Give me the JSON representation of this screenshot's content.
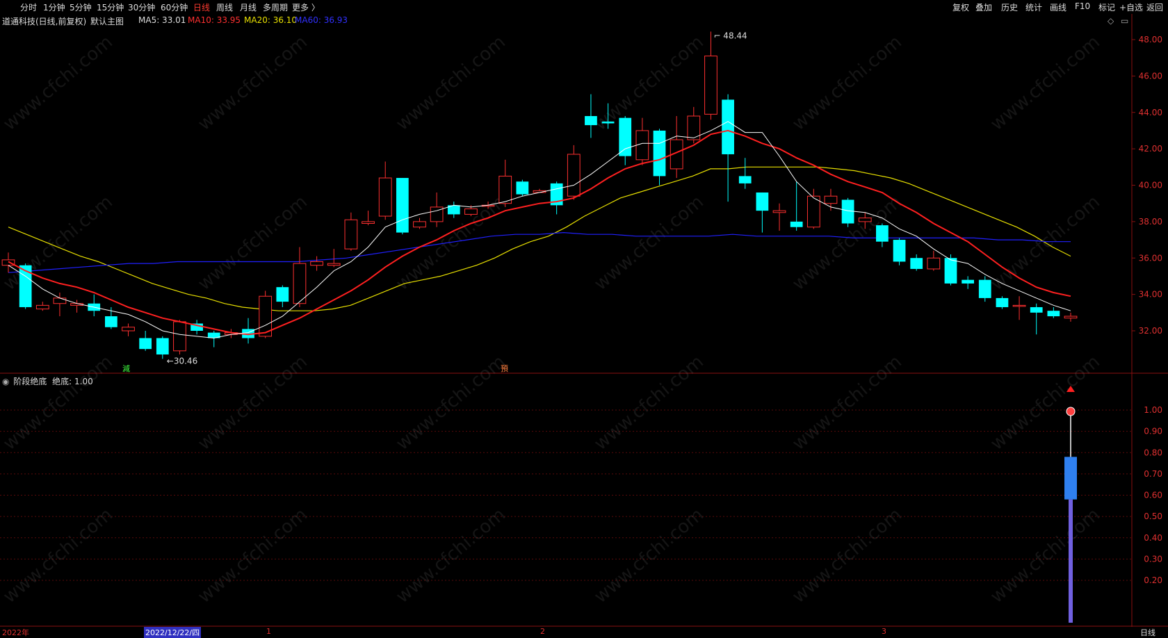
{
  "topbar": {
    "left": [
      "分时",
      "1分钟",
      "5分钟",
      "15分钟",
      "30分钟",
      "60分钟",
      "日线",
      "周线",
      "月线",
      "多周期",
      "更多 〉"
    ],
    "active": "日线",
    "right": [
      "复权",
      "叠加",
      "历史",
      "统计",
      "画线",
      "F10",
      "标记",
      "+自选",
      "返回"
    ]
  },
  "infobar": {
    "stock": "道通科技(日线,前复权)",
    "template": "默认主图",
    "ma5": "MA5: 33.01",
    "ma10": "MA10: 33.95",
    "ma20": "MA20: 36.10",
    "ma60": "MA60: 36.93"
  },
  "indicator": {
    "title": "阶段绝底",
    "value": "绝底: 1.00"
  },
  "price_axis": [
    "48.00",
    "46.00",
    "44.00",
    "42.00",
    "40.00",
    "38.00",
    "36.00",
    "34.00",
    "32.00"
  ],
  "ind_axis": [
    "1.00",
    "0.90",
    "0.80",
    "0.70",
    "0.60",
    "0.50",
    "0.40",
    "0.30",
    "0.20"
  ],
  "annotations": {
    "high": "48.44",
    "low": "←30.46",
    "mark1": "減",
    "mark2": "預"
  },
  "footer": {
    "year": "2022年",
    "date": "2022/12/22/四",
    "m1": "1",
    "m2": "2",
    "m3": "3",
    "period": "日线"
  },
  "watermark": "www.cfchi.com",
  "colors": {
    "up": "#ff3030",
    "down": "#00ffff",
    "ma5": "#ffffff",
    "ma10": "#ff2020",
    "ma20": "#e8e000",
    "ma60": "#2020ff"
  },
  "chart_data": {
    "type": "candlestick",
    "candles": [
      {
        "o": 35.6,
        "c": 35.9,
        "h": 36.3,
        "l": 35.2
      },
      {
        "o": 35.6,
        "c": 33.3,
        "h": 35.7,
        "l": 33.2
      },
      {
        "o": 33.2,
        "c": 33.4,
        "h": 33.6,
        "l": 33.1
      },
      {
        "o": 33.5,
        "c": 33.8,
        "h": 34.1,
        "l": 32.8
      },
      {
        "o": 33.4,
        "c": 33.5,
        "h": 33.7,
        "l": 33.0
      },
      {
        "o": 33.5,
        "c": 33.1,
        "h": 34.0,
        "l": 32.8
      },
      {
        "o": 32.8,
        "c": 32.2,
        "h": 33.3,
        "l": 32.1
      },
      {
        "o": 32.0,
        "c": 32.2,
        "h": 32.4,
        "l": 31.7
      },
      {
        "o": 31.6,
        "c": 31.0,
        "h": 32.0,
        "l": 30.9
      },
      {
        "o": 31.6,
        "c": 30.7,
        "h": 31.7,
        "l": 30.46
      },
      {
        "o": 30.9,
        "c": 32.5,
        "h": 32.6,
        "l": 30.7
      },
      {
        "o": 32.4,
        "c": 32.0,
        "h": 32.6,
        "l": 31.8
      },
      {
        "o": 31.9,
        "c": 31.6,
        "h": 32.0,
        "l": 31.1
      },
      {
        "o": 31.8,
        "c": 31.9,
        "h": 32.1,
        "l": 31.6
      },
      {
        "o": 32.1,
        "c": 31.6,
        "h": 32.7,
        "l": 31.3
      },
      {
        "o": 31.7,
        "c": 33.9,
        "h": 34.2,
        "l": 31.6
      },
      {
        "o": 34.4,
        "c": 33.6,
        "h": 34.5,
        "l": 33.3
      },
      {
        "o": 33.5,
        "c": 35.7,
        "h": 36.6,
        "l": 33.3
      },
      {
        "o": 35.6,
        "c": 35.8,
        "h": 36.1,
        "l": 35.3
      },
      {
        "o": 35.6,
        "c": 35.7,
        "h": 36.5,
        "l": 35.5
      },
      {
        "o": 36.5,
        "c": 38.1,
        "h": 38.5,
        "l": 36.4
      },
      {
        "o": 37.9,
        "c": 38.0,
        "h": 38.6,
        "l": 37.8
      },
      {
        "o": 38.3,
        "c": 40.4,
        "h": 41.3,
        "l": 38.1
      },
      {
        "o": 40.4,
        "c": 37.4,
        "h": 40.4,
        "l": 37.3
      },
      {
        "o": 37.7,
        "c": 38.0,
        "h": 38.2,
        "l": 37.6
      },
      {
        "o": 38.0,
        "c": 38.8,
        "h": 39.6,
        "l": 37.7
      },
      {
        "o": 38.9,
        "c": 38.4,
        "h": 39.1,
        "l": 38.2
      },
      {
        "o": 38.4,
        "c": 38.7,
        "h": 38.9,
        "l": 38.3
      },
      {
        "o": 38.9,
        "c": 38.9,
        "h": 39.1,
        "l": 38.7
      },
      {
        "o": 39.0,
        "c": 40.5,
        "h": 41.4,
        "l": 38.8
      },
      {
        "o": 40.2,
        "c": 39.5,
        "h": 40.3,
        "l": 39.4
      },
      {
        "o": 39.6,
        "c": 39.7,
        "h": 39.8,
        "l": 39.6
      },
      {
        "o": 40.1,
        "c": 38.9,
        "h": 40.2,
        "l": 38.4
      },
      {
        "o": 39.4,
        "c": 41.7,
        "h": 42.2,
        "l": 39.2
      },
      {
        "o": 43.8,
        "c": 43.3,
        "h": 45.0,
        "l": 42.6
      },
      {
        "o": 43.5,
        "c": 43.4,
        "h": 44.5,
        "l": 43.1
      },
      {
        "o": 43.7,
        "c": 41.6,
        "h": 43.8,
        "l": 41.1
      },
      {
        "o": 41.4,
        "c": 43.0,
        "h": 43.7,
        "l": 41.1
      },
      {
        "o": 43.0,
        "c": 40.5,
        "h": 43.1,
        "l": 40.0
      },
      {
        "o": 40.9,
        "c": 42.5,
        "h": 43.8,
        "l": 40.4
      },
      {
        "o": 42.5,
        "c": 43.8,
        "h": 44.3,
        "l": 42.3
      },
      {
        "o": 43.9,
        "c": 47.1,
        "h": 48.44,
        "l": 43.6
      },
      {
        "o": 44.7,
        "c": 41.7,
        "h": 45.0,
        "l": 39.1
      },
      {
        "o": 40.5,
        "c": 40.1,
        "h": 41.5,
        "l": 39.8
      },
      {
        "o": 39.6,
        "c": 38.6,
        "h": 39.6,
        "l": 37.4
      },
      {
        "o": 38.5,
        "c": 38.6,
        "h": 39.0,
        "l": 37.5
      },
      {
        "o": 38.0,
        "c": 37.7,
        "h": 40.2,
        "l": 37.5
      },
      {
        "o": 37.7,
        "c": 39.4,
        "h": 39.8,
        "l": 37.6
      },
      {
        "o": 39.0,
        "c": 39.4,
        "h": 39.8,
        "l": 38.6
      },
      {
        "o": 39.2,
        "c": 37.9,
        "h": 39.3,
        "l": 37.7
      },
      {
        "o": 38.0,
        "c": 38.2,
        "h": 38.5,
        "l": 37.6
      },
      {
        "o": 37.8,
        "c": 36.9,
        "h": 37.9,
        "l": 36.6
      },
      {
        "o": 37.0,
        "c": 35.8,
        "h": 37.1,
        "l": 35.6
      },
      {
        "o": 36.0,
        "c": 35.4,
        "h": 36.2,
        "l": 35.3
      },
      {
        "o": 35.4,
        "c": 36.0,
        "h": 36.4,
        "l": 35.3
      },
      {
        "o": 36.0,
        "c": 34.6,
        "h": 36.2,
        "l": 34.5
      },
      {
        "o": 34.8,
        "c": 34.6,
        "h": 35.0,
        "l": 34.3
      },
      {
        "o": 34.8,
        "c": 33.8,
        "h": 35.0,
        "l": 33.6
      },
      {
        "o": 33.8,
        "c": 33.3,
        "h": 33.9,
        "l": 33.2
      },
      {
        "o": 33.4,
        "c": 33.4,
        "h": 33.9,
        "l": 32.6
      },
      {
        "o": 33.3,
        "c": 33.0,
        "h": 33.5,
        "l": 31.8
      },
      {
        "o": 33.1,
        "c": 32.8,
        "h": 33.3,
        "l": 32.7
      },
      {
        "o": 32.7,
        "c": 32.8,
        "h": 33.0,
        "l": 32.5
      }
    ],
    "ma5": [
      35.6,
      35.0,
      34.3,
      33.8,
      33.5,
      33.3,
      33.1,
      32.9,
      32.5,
      32.0,
      31.8,
      31.7,
      31.6,
      31.8,
      31.9,
      32.3,
      32.8,
      33.6,
      34.4,
      35.3,
      35.8,
      36.6,
      37.7,
      38.1,
      38.4,
      38.6,
      38.9,
      38.8,
      38.9,
      39.1,
      39.4,
      39.6,
      39.8,
      40.0,
      40.6,
      41.3,
      42.0,
      42.3,
      42.3,
      42.7,
      42.6,
      43.0,
      43.5,
      42.9,
      42.9,
      41.6,
      40.2,
      39.3,
      38.8,
      38.6,
      38.5,
      38.2,
      37.6,
      37.2,
      36.5,
      35.9,
      35.7,
      35.1,
      34.6,
      34.2,
      33.8,
      33.4,
      33.1
    ],
    "ma10": [
      35.8,
      35.3,
      34.9,
      34.6,
      34.4,
      34.1,
      33.7,
      33.3,
      33.0,
      32.7,
      32.5,
      32.3,
      32.1,
      31.9,
      31.8,
      31.9,
      32.3,
      32.7,
      33.2,
      33.7,
      34.2,
      34.8,
      35.5,
      36.1,
      36.6,
      37.0,
      37.5,
      37.9,
      38.2,
      38.6,
      38.8,
      39.0,
      39.1,
      39.3,
      39.8,
      40.4,
      40.9,
      41.2,
      41.4,
      41.8,
      42.2,
      42.8,
      43.0,
      42.7,
      42.3,
      42.0,
      41.5,
      41.1,
      40.6,
      40.2,
      39.9,
      39.6,
      39.0,
      38.5,
      37.9,
      37.4,
      36.9,
      36.2,
      35.5,
      34.9,
      34.4,
      34.1,
      33.9
    ],
    "ma20": [
      37.7,
      37.3,
      36.9,
      36.5,
      36.1,
      35.8,
      35.4,
      35.0,
      34.6,
      34.3,
      34.0,
      33.8,
      33.5,
      33.3,
      33.2,
      33.1,
      33.1,
      33.1,
      33.2,
      33.4,
      33.8,
      34.2,
      34.6,
      34.8,
      35.0,
      35.3,
      35.6,
      36.0,
      36.5,
      36.9,
      37.2,
      37.7,
      38.3,
      38.8,
      39.3,
      39.6,
      39.9,
      40.2,
      40.5,
      40.9,
      40.9,
      41.0,
      41.0,
      41.0,
      41.0,
      41.0,
      40.9,
      40.8,
      40.6,
      40.4,
      40.1,
      39.7,
      39.3,
      38.9,
      38.5,
      38.1,
      37.7,
      37.2,
      36.6,
      36.1
    ],
    "ma60": [
      35.2,
      35.3,
      35.4,
      35.5,
      35.6,
      35.7,
      35.7,
      35.8,
      35.8,
      35.8,
      35.8,
      35.8,
      35.8,
      35.9,
      36.0,
      36.2,
      36.4,
      36.6,
      36.8,
      37.0,
      37.2,
      37.3,
      37.3,
      37.4,
      37.3,
      37.3,
      37.2,
      37.2,
      37.2,
      37.2,
      37.3,
      37.2,
      37.2,
      37.2,
      37.2,
      37.1,
      37.1,
      37.1,
      37.1,
      37.1,
      37.1,
      37.0,
      37.0,
      36.9,
      36.9
    ],
    "price_range": [
      30,
      49.2
    ],
    "indicator": {
      "value": 1.0,
      "bar_bottom_blue": 0.58,
      "bar_top_blue": 0.78,
      "line_top": 1.0,
      "range": [
        0.0,
        1.1
      ]
    }
  }
}
